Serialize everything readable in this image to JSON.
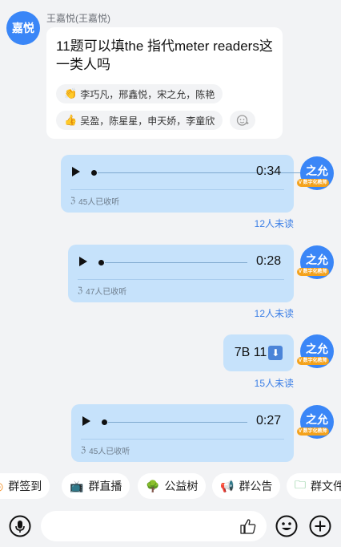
{
  "sender": {
    "avatar_text": "嘉悦",
    "name": "王嘉悦(王嘉悦)",
    "message": "11题可以填the 指代meter readers这一类人吗",
    "reactions": [
      {
        "emoji": "👏",
        "users": "李巧凡，邢鑫悦，宋之允，陈艳"
      },
      {
        "emoji": "👍",
        "users": "吴盈，陈星星，申天娇，李童欣"
      }
    ]
  },
  "self_avatar": {
    "text": "之允",
    "badge": "V 数字化教师"
  },
  "messages": [
    {
      "type": "voice",
      "duration": "0:34",
      "listened": "45人已收听",
      "unread": "12人未读"
    },
    {
      "type": "voice",
      "duration": "0:28",
      "listened": "47人已收听",
      "unread": "12人未读"
    },
    {
      "type": "text",
      "text": "7B 11",
      "unread": "15人未读"
    },
    {
      "type": "voice",
      "duration": "0:27",
      "listened": "45人已收听"
    }
  ],
  "quick_actions": [
    {
      "label": "群签到",
      "icon": "checkin-icon"
    },
    {
      "label": "群直播",
      "icon": "live-tv-icon"
    },
    {
      "label": "公益树",
      "icon": "tree-icon"
    },
    {
      "label": "群公告",
      "icon": "megaphone-icon"
    },
    {
      "label": "群文件",
      "icon": "folder-icon"
    }
  ],
  "colors": {
    "accent": "#3a86f7",
    "bubble": "#c6e2fb",
    "unread": "#3a7ee6",
    "background": "#f2f3f5"
  }
}
